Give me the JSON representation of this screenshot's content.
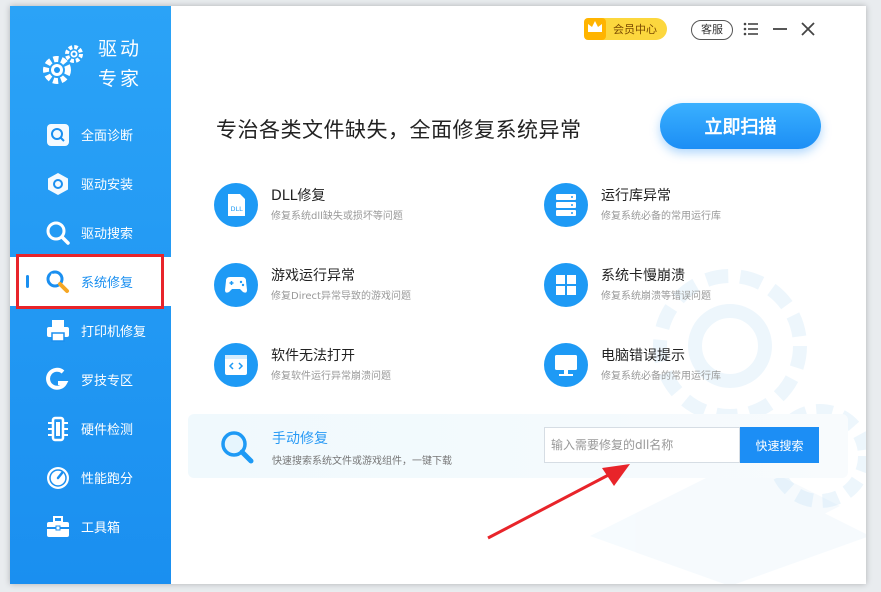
{
  "app": {
    "logo_text_line1": "驱动",
    "logo_text_line2": "专家"
  },
  "sidebar": {
    "items": [
      {
        "label": "全面诊断",
        "icon": "diagnose-icon"
      },
      {
        "label": "驱动安装",
        "icon": "install-icon"
      },
      {
        "label": "驱动搜索",
        "icon": "search-icon"
      },
      {
        "label": "系统修复",
        "icon": "wrench-icon",
        "active": true
      },
      {
        "label": "打印机修复",
        "icon": "printer-icon"
      },
      {
        "label": "罗技专区",
        "icon": "logitech-icon"
      },
      {
        "label": "硬件检测",
        "icon": "hardware-icon"
      },
      {
        "label": "性能跑分",
        "icon": "gauge-icon"
      },
      {
        "label": "工具箱",
        "icon": "toolbox-icon"
      }
    ]
  },
  "topbar": {
    "vip_label": "会员中心",
    "service_label": "客服"
  },
  "main": {
    "headline": "专治各类文件缺失，全面修复系统异常",
    "scan_button": "立即扫描",
    "features": [
      {
        "title": "DLL修复",
        "desc": "修复系统dll缺失或损坏等问题",
        "icon_text": "DLL"
      },
      {
        "title": "运行库异常",
        "desc": "修复系统必备的常用运行库"
      },
      {
        "title": "游戏运行异常",
        "desc": "修复Direct异常导致的游戏问题"
      },
      {
        "title": "系统卡慢崩溃",
        "desc": "修复系统崩溃等错误问题"
      },
      {
        "title": "软件无法打开",
        "desc": "修复软件运行异常崩溃问题"
      },
      {
        "title": "电脑错误提示",
        "desc": "修复系统必备的常用运行库"
      }
    ],
    "manual": {
      "title": "手动修复",
      "desc": "快速搜索系统文件或游戏组件，一键下载",
      "placeholder": "输入需要修复的dll名称",
      "search_button": "快速搜索"
    }
  },
  "colors": {
    "sidebar": "#1a8ff0",
    "accent": "#1c8ef5",
    "highlight": "#e8242a",
    "vip": "#fcd73e"
  }
}
